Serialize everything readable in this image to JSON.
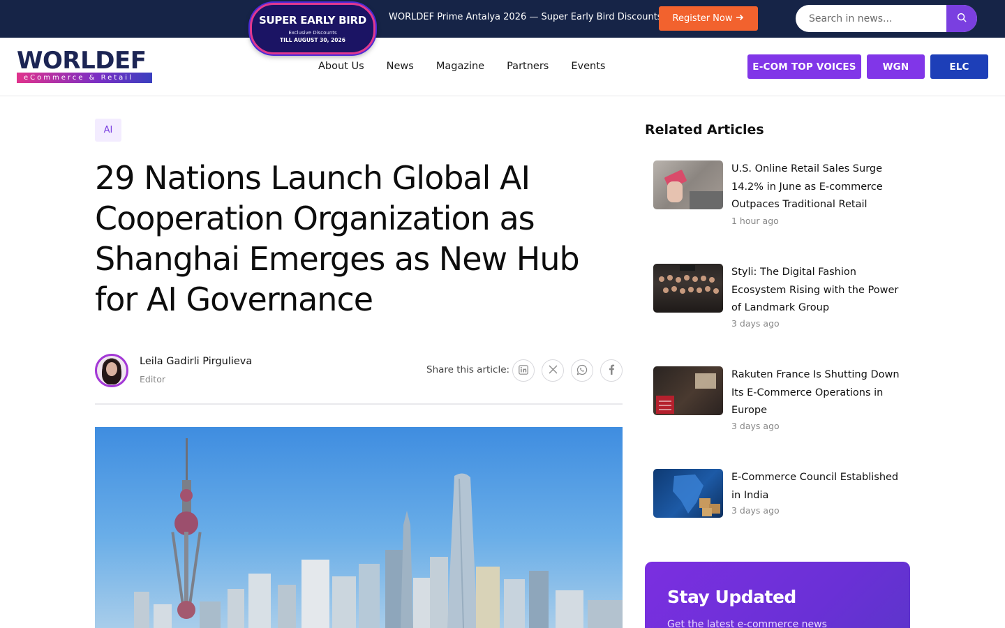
{
  "topbar": {
    "badge": {
      "line1": "SUPER EARLY BIRD",
      "line2": "Exclusive Discounts",
      "line3": "TILL AUGUST 30, 2026"
    },
    "promo_text": "WORLDEF Prime Antalya 2026 — Super Early Bird Discounts",
    "register_label": "Register Now",
    "search_placeholder": "Search in news..."
  },
  "header": {
    "logo_word": "WORLDEF",
    "logo_tagline": "eCommerce & Retail",
    "nav": [
      "About Us",
      "News",
      "Magazine",
      "Partners",
      "Events"
    ],
    "pills": {
      "ecom": "E-COM TOP VOICES",
      "wgn": "WGN",
      "elc": "ELC"
    }
  },
  "article": {
    "tag": "AI",
    "title": "29 Nations Launch Global AI Cooperation Organization as Shanghai Emerges as New Hub for AI Governance",
    "author_name": "Leila Gadirli Pirgulieva",
    "author_role": "Editor",
    "share_label": "Share this article:"
  },
  "sidebar": {
    "related_title": "Related Articles",
    "items": [
      {
        "title": "U.S. Online Retail Sales Surge 14.2% in June as E-commerce Outpaces Traditional Retail",
        "time": "1 hour ago"
      },
      {
        "title": "Styli: The Digital Fashion Ecosystem Rising with the Power of Landmark Group",
        "time": "3 days ago"
      },
      {
        "title": "Rakuten France Is Shutting Down Its E-Commerce Operations in Europe",
        "time": "3 days ago"
      },
      {
        "title": "E-Commerce Council Established in India",
        "time": "3 days ago"
      }
    ],
    "newsletter_title": "Stay Updated",
    "newsletter_sub": "Get the latest e-commerce news"
  },
  "colors": {
    "topbar_bg": "#162447",
    "accent_purple": "#8136e8",
    "accent_orange": "#f2622e",
    "accent_blue": "#1d3fb8"
  }
}
